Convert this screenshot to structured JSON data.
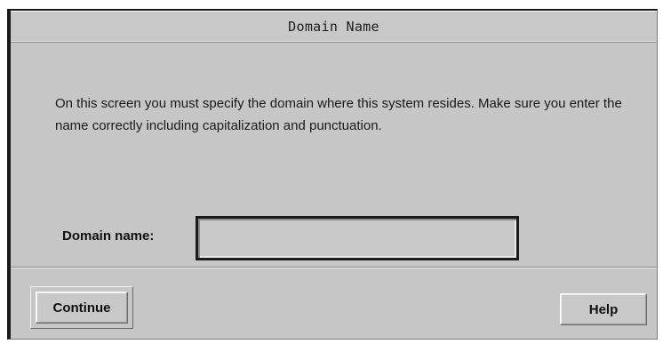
{
  "window": {
    "title": "Domain Name"
  },
  "main": {
    "instructions": "On this screen you must specify the domain where this system resides. Make sure you enter the name correctly including capitalization and punctuation.",
    "domain_label": "Domain name:",
    "domain_value": ""
  },
  "buttons": {
    "continue_label": "Continue",
    "help_label": "Help"
  }
}
